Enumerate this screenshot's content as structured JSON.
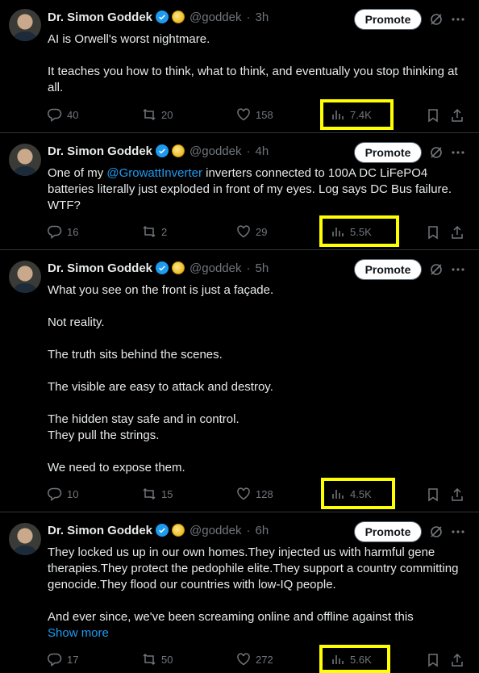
{
  "author": {
    "name": "Dr. Simon Goddek",
    "handle": "@goddek"
  },
  "promote_label": "Promote",
  "colors": {
    "highlight": "#ffff00",
    "link": "#1d9bf0",
    "muted": "#71767b",
    "verified": "#1d9bf0"
  },
  "tweets": [
    {
      "time": "3h",
      "lines": [
        "AI is Orwell's worst nightmare.",
        "",
        "It teaches you how to think, what to think, and eventually you stop thinking at all."
      ],
      "replies": "40",
      "reposts": "20",
      "likes": "158",
      "views": "7.4K"
    },
    {
      "time": "4h",
      "pre": "One of my ",
      "mention": "@GrowattInverter",
      "post": "  inverters connected to 100A DC LiFePO4 batteries literally just exploded in front of my eyes. Log says DC Bus failure. WTF?",
      "replies": "16",
      "reposts": "2",
      "likes": "29",
      "views": "5.5K"
    },
    {
      "time": "5h",
      "lines": [
        "What you see on the front is just a façade.",
        "",
        "Not reality.",
        "",
        "The truth sits behind the scenes.",
        "",
        "The visible are easy to attack and destroy.",
        "",
        "The hidden stay safe and in control.",
        "They pull the strings.",
        "",
        "We need to expose them."
      ],
      "replies": "10",
      "reposts": "15",
      "likes": "128",
      "views": "4.5K"
    },
    {
      "time": "6h",
      "lines": [
        "They locked us up in our own homes.They injected us with harmful gene therapies.They protect the pedophile elite.They support a country committing genocide.They flood our countries with low-IQ people.",
        "",
        "And ever since, we've been screaming online and offline against this"
      ],
      "show_more": "Show more",
      "replies": "17",
      "reposts": "50",
      "likes": "272",
      "views": "5.6K"
    }
  ]
}
